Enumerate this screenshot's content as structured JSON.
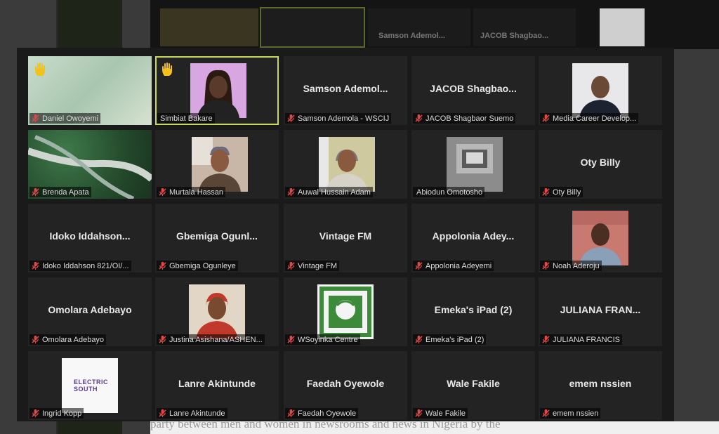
{
  "top_strip": {
    "names": [
      "Samson Ademol...",
      "JACOB Shagbao..."
    ]
  },
  "background_text": "party between men and women in newsrooms and news in Nigeria by the",
  "tiles": [
    {
      "label": "Daniel Owoyemi",
      "center": "",
      "video": "blur-green",
      "hand": true,
      "muted": true
    },
    {
      "label": "Simbiat Bakare",
      "center": "",
      "video": "person-purple",
      "hand": true,
      "muted": false,
      "active": true
    },
    {
      "label": "Samson Ademola - WSCIJ",
      "center": "Samson Ademol...",
      "video": "",
      "hand": false,
      "muted": true
    },
    {
      "label": "JACOB Shagbaor Suemo",
      "center": "JACOB Shagbao...",
      "video": "",
      "hand": false,
      "muted": true
    },
    {
      "label": "Media Career Develop...",
      "center": "",
      "video": "person-suit",
      "hand": false,
      "muted": true
    },
    {
      "label": "Brenda Apata",
      "center": "",
      "video": "nature-road",
      "hand": false,
      "muted": true
    },
    {
      "label": "Murtala Hassan",
      "center": "",
      "video": "person-room",
      "hand": false,
      "muted": true
    },
    {
      "label": "Auwal Hussain Adam",
      "center": "",
      "video": "person-cap",
      "hand": false,
      "muted": true
    },
    {
      "label": "Abiodun Omotosho",
      "center": "",
      "video": "ceiling",
      "hand": false,
      "muted": false
    },
    {
      "label": "Oty Billy",
      "center": "Oty Billy",
      "video": "",
      "hand": false,
      "muted": true
    },
    {
      "label": "Idoko Iddahson 821/OI/...",
      "center": "Idoko Iddahson...",
      "video": "",
      "hand": false,
      "muted": true
    },
    {
      "label": "Gbemiga Ogunleye",
      "center": "Gbemiga Ogunl...",
      "video": "",
      "hand": false,
      "muted": true
    },
    {
      "label": "Vintage FM",
      "center": "Vintage FM",
      "video": "",
      "hand": false,
      "muted": true
    },
    {
      "label": "Appolonia Adeyemi",
      "center": "Appolonia Adey...",
      "video": "",
      "hand": false,
      "muted": true
    },
    {
      "label": "Noah Aderoju",
      "center": "",
      "video": "person-plaid",
      "hand": false,
      "muted": true
    },
    {
      "label": "Omolara Adebayo",
      "center": "Omolara Adebayo",
      "video": "",
      "hand": false,
      "muted": true
    },
    {
      "label": "Justina Asishana/ASHEN...",
      "center": "",
      "video": "person-red",
      "hand": false,
      "muted": true
    },
    {
      "label": "WSoyinka Centre",
      "center": "",
      "video": "logo-green",
      "hand": false,
      "muted": true
    },
    {
      "label": "Emeka's iPad (2)",
      "center": "Emeka's iPad (2)",
      "video": "",
      "hand": false,
      "muted": true
    },
    {
      "label": "JULIANA FRANCIS",
      "center": "JULIANA FRAN...",
      "video": "",
      "hand": false,
      "muted": true
    },
    {
      "label": "Ingrid Kopp",
      "center": "",
      "video": "logo-electric",
      "logo_text": "ELECTRIC SOUTH",
      "hand": false,
      "muted": true
    },
    {
      "label": "Lanre Akintunde",
      "center": "Lanre Akintunde",
      "video": "",
      "hand": false,
      "muted": true
    },
    {
      "label": "Faedah Oyewole",
      "center": "Faedah Oyewole",
      "video": "",
      "hand": false,
      "muted": true
    },
    {
      "label": "Wale Fakile",
      "center": "Wale Fakile",
      "video": "",
      "hand": false,
      "muted": true
    },
    {
      "label": "emem nssien",
      "center": "emem nssien",
      "video": "",
      "hand": false,
      "muted": true
    }
  ],
  "colors": {
    "active_border": "#c8d85a",
    "muted_icon": "#e04848",
    "tile_bg": "#232323"
  }
}
